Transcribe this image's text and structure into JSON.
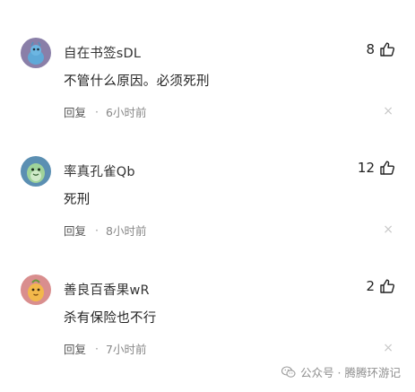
{
  "comments": [
    {
      "username": "自在书签sDL",
      "likes": "8",
      "content": "不管什么原因。必须死刑",
      "reply_label": "回复",
      "separator": "·",
      "time": "6小时前",
      "close_glyph": "×",
      "avatar_color": "#8a7fa8"
    },
    {
      "username": "率真孔雀Qb",
      "likes": "12",
      "content": "死刑",
      "reply_label": "回复",
      "separator": "·",
      "time": "8小时前",
      "close_glyph": "×",
      "avatar_color": "#5b8fb2"
    },
    {
      "username": "善良百香果wR",
      "likes": "2",
      "content": "杀有保险也不行",
      "reply_label": "回复",
      "separator": "·",
      "time": "7小时前",
      "close_glyph": "×",
      "avatar_color": "#d98e8e"
    }
  ],
  "watermark": {
    "text": "公众号 · 腾腾环游记",
    "icon": "wechat-icon"
  }
}
